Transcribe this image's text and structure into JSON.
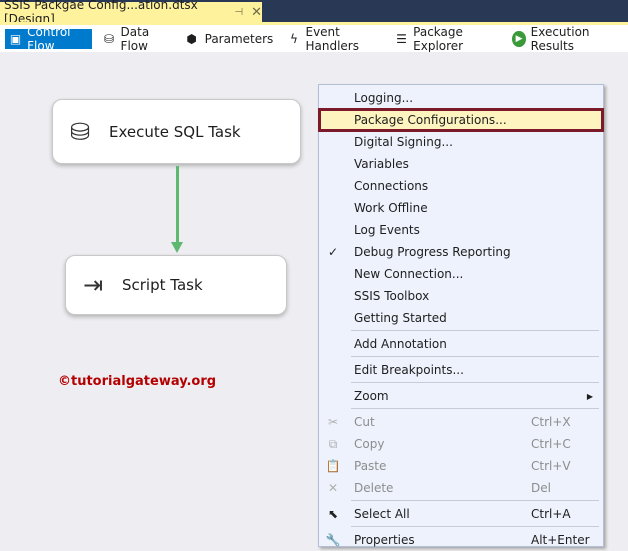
{
  "doc_tab": {
    "title": "SSIS Packgae Config...ation.dtsx [Design]",
    "pin": "⊣",
    "close": "✕"
  },
  "toolbar": [
    {
      "label": "Control Flow",
      "icon": "control-flow-icon",
      "glyph": "▣",
      "active": true
    },
    {
      "label": "Data Flow",
      "icon": "data-flow-icon",
      "glyph": "⛁"
    },
    {
      "label": "Parameters",
      "icon": "parameters-icon",
      "glyph": "⬢"
    },
    {
      "label": "Event Handlers",
      "icon": "event-handlers-icon",
      "glyph": "ϟ"
    },
    {
      "label": "Package Explorer",
      "icon": "package-explorer-icon",
      "glyph": "☰"
    },
    {
      "label": "Execution Results",
      "icon": "execution-results-icon",
      "glyph": "▶"
    }
  ],
  "tasks": [
    {
      "label": "Execute SQL Task",
      "glyph": "⛁"
    },
    {
      "label": "Script Task",
      "glyph": "⇥"
    }
  ],
  "watermark": "©tutorialgateway.org",
  "menu": [
    {
      "label": "Logging..."
    },
    {
      "label": "Package Configurations...",
      "highlighted": true
    },
    {
      "label": "Digital Signing..."
    },
    {
      "label": "Variables"
    },
    {
      "label": "Connections"
    },
    {
      "label": "Work Offline"
    },
    {
      "label": "Log Events"
    },
    {
      "label": "Debug Progress Reporting",
      "check": "✓"
    },
    {
      "label": "New Connection..."
    },
    {
      "label": "SSIS Toolbox"
    },
    {
      "label": "Getting Started"
    },
    {
      "sep": true
    },
    {
      "label": "Add Annotation"
    },
    {
      "sep": true
    },
    {
      "label": "Edit Breakpoints..."
    },
    {
      "sep": true
    },
    {
      "label": "Zoom",
      "submenu": "▶"
    },
    {
      "sep": true
    },
    {
      "label": "Cut",
      "shortcut": "Ctrl+X",
      "icon": "✂",
      "disabled": true
    },
    {
      "label": "Copy",
      "shortcut": "Ctrl+C",
      "icon": "⧉",
      "disabled": true
    },
    {
      "label": "Paste",
      "shortcut": "Ctrl+V",
      "icon": "📋",
      "disabled": true
    },
    {
      "label": "Delete",
      "shortcut": "Del",
      "icon": "✕",
      "disabled": true
    },
    {
      "sep": true
    },
    {
      "label": "Select All",
      "shortcut": "Ctrl+A",
      "icon": "⬉"
    },
    {
      "sep": true
    },
    {
      "label": "Properties",
      "shortcut": "Alt+Enter",
      "icon": "🔧"
    }
  ],
  "colors": {
    "accent": "#007acc",
    "tab": "#fff29d",
    "highlight_border": "#7a1a2a",
    "connector": "#5fb870"
  }
}
